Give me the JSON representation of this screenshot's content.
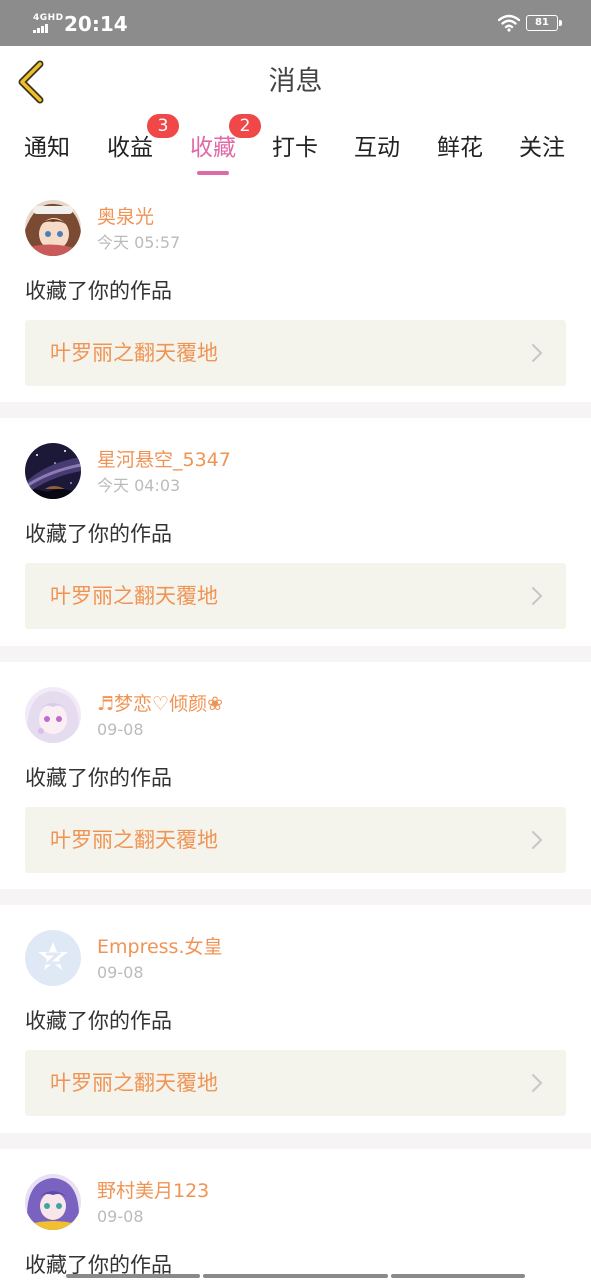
{
  "status_bar": {
    "network": "4GHD",
    "time": "20:14",
    "battery": "81"
  },
  "header": {
    "title": "消息",
    "back_icon": "chevron-left-icon",
    "back_color": "#f0c02c"
  },
  "tabs": [
    {
      "label": "通知",
      "badge": ""
    },
    {
      "label": "收益",
      "badge": "3"
    },
    {
      "label": "收藏",
      "badge": "2",
      "active": true
    },
    {
      "label": "打卡",
      "badge": ""
    },
    {
      "label": "互动",
      "badge": ""
    },
    {
      "label": "鲜花",
      "badge": ""
    },
    {
      "label": "关注",
      "badge": ""
    }
  ],
  "accent_color": "#e06aa8",
  "username_color": "#f09455",
  "badge_color": "#f04848",
  "messages": [
    {
      "user": "奥泉光",
      "time": "今天 05:57",
      "action": "收藏了你的作品",
      "work": "叶罗丽之翻天覆地",
      "avatar_icon": "anime-girl-avatar"
    },
    {
      "user": "星河悬空_5347",
      "time": "今天 04:03",
      "action": "收藏了你的作品",
      "work": "叶罗丽之翻天覆地",
      "avatar_icon": "galaxy-avatar"
    },
    {
      "user": "♬梦恋♡倾颜❀",
      "time": "09-08",
      "action": "收藏了你的作品",
      "work": "叶罗丽之翻天覆地",
      "avatar_icon": "anime-girl-white-hair-avatar"
    },
    {
      "user": "Empress.女皇",
      "time": "09-08",
      "action": "收藏了你的作品",
      "work": "叶罗丽之翻天覆地",
      "avatar_icon": "default-qzone-avatar"
    },
    {
      "user": "野村美月123",
      "time": "09-08",
      "action": "收藏了你的作品",
      "work": "",
      "avatar_icon": "anime-girl-purple-hair-avatar"
    }
  ]
}
